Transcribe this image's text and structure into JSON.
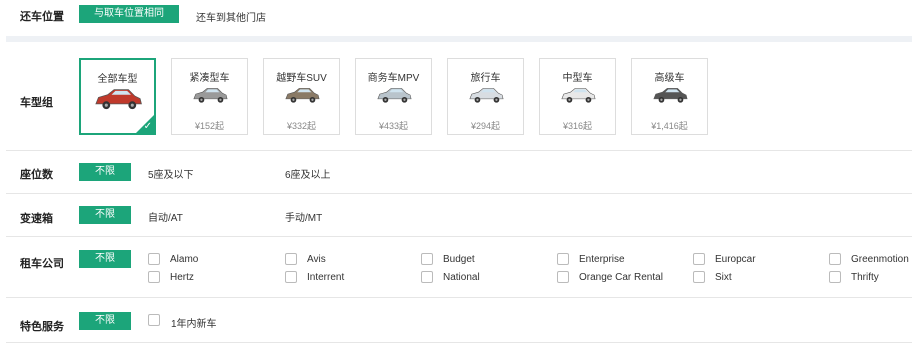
{
  "return_location": {
    "label": "还车位置",
    "selected": "与取车位置相同",
    "other": "还车到其他门店"
  },
  "car_type": {
    "label": "车型组",
    "cards": [
      {
        "name": "全部车型",
        "price": "",
        "selected": true,
        "color": "#c0392b"
      },
      {
        "name": "紧凑型车",
        "price": "¥152起",
        "selected": false,
        "color": "#9a9a9a"
      },
      {
        "name": "越野车SUV",
        "price": "¥332起",
        "selected": false,
        "color": "#8a7a66"
      },
      {
        "name": "商务车MPV",
        "price": "¥433起",
        "selected": false,
        "color": "#b9c4cc"
      },
      {
        "name": "旅行车",
        "price": "¥294起",
        "selected": false,
        "color": "#d8dde2"
      },
      {
        "name": "中型车",
        "price": "¥316起",
        "selected": false,
        "color": "#e8e8e8"
      },
      {
        "name": "高级车",
        "price": "¥1,416起",
        "selected": false,
        "color": "#555555"
      }
    ]
  },
  "seats": {
    "label": "座位数",
    "unlimited": "不限",
    "options": [
      "5座及以下",
      "6座及以上"
    ]
  },
  "transmission": {
    "label": "变速箱",
    "unlimited": "不限",
    "options": [
      "自动/AT",
      "手动/MT"
    ]
  },
  "rental_company": {
    "label": "租车公司",
    "unlimited": "不限",
    "row1": [
      "Alamo",
      "Avis",
      "Budget",
      "Enterprise",
      "Europcar",
      "Greenmotion"
    ],
    "row2": [
      "Hertz",
      "Interrent",
      "National",
      "Orange Car Rental",
      "Sixt",
      "Thrifty"
    ]
  },
  "special_service": {
    "label": "特色服务",
    "unlimited": "不限",
    "options": [
      "1年内新车"
    ]
  },
  "accent_color": "#1ca57a"
}
